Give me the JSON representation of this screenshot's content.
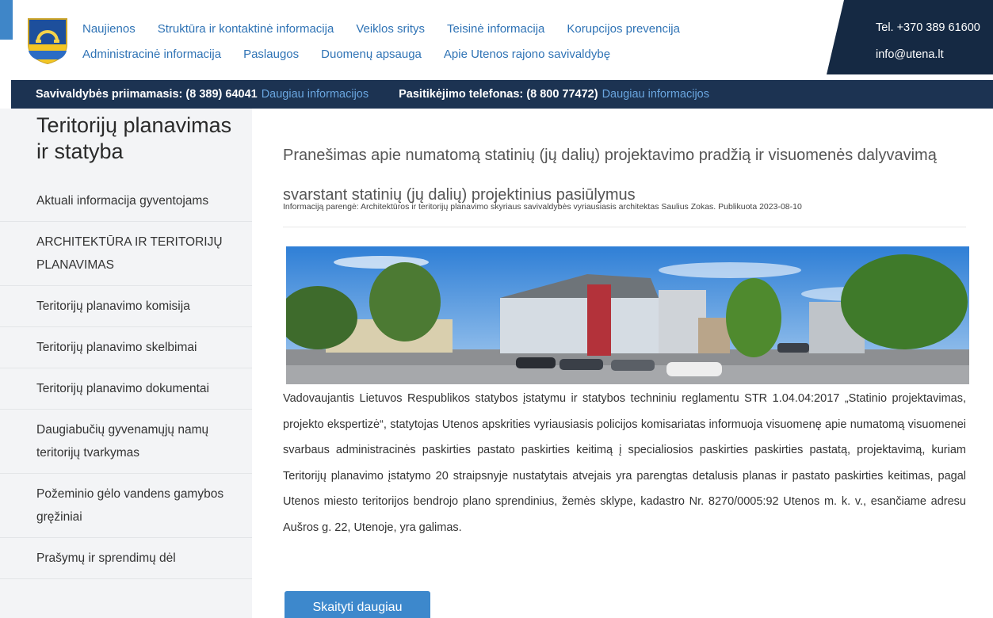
{
  "header": {
    "nav_row1": [
      "Naujienos",
      "Struktūra ir kontaktinė informacija",
      "Veiklos sritys",
      "Teisinė informacija",
      "Korupcijos prevencija"
    ],
    "nav_row2": [
      "Administracinė informacija",
      "Paslaugos",
      "Duomenų apsauga",
      "Apie Utenos rajono savivaldybę"
    ],
    "phone": "Tel. +370 389 61600",
    "email": "info@utena.lt",
    "accent_color": "#3f86c8",
    "dark_color": "#152943"
  },
  "infobar": {
    "reception_label": "Savivaldybės priimamasis: (8 389) 64041",
    "reception_link": "Daugiau informacijos",
    "trust_label": "Pasitikėjimo telefonas: (8 800 77472)",
    "trust_link": "Daugiau informacijos"
  },
  "sidebar": {
    "title": "Teritorijų planavimas ir statyba",
    "items": [
      "Aktuali informacija gyventojams",
      "ARCHITEKTŪRA IR TERITORIJŲ PLANAVIMAS",
      "Teritorijų planavimo komisija",
      "Teritorijų planavimo skelbimai",
      "Teritorijų planavimo dokumentai",
      "Daugiabučių gyvenamųjų namų teritorijų tvarkymas",
      "Požeminio gėlo vandens gamybos gręžiniai",
      "Prašymų ir sprendimų dėl"
    ]
  },
  "article": {
    "title": "Pranešimas apie numatomą statinių (jų dalių) projektavimo pradžią ir visuomenės dalyvavimą svarstant statinių (jų dalių) projektinius pasiūlymus",
    "meta": "Informaciją parengė: Architektūros ir teritorijų planavimo skyriaus savivaldybės vyriausiasis architektas Saulius Zokas. Publikuota 2023-08-10",
    "body": "Vadovaujantis Lietuvos Respublikos statybos įstatymu ir statybos techniniu reglamentu STR 1.04.04:2017 „Statinio projektavimas, projekto ekspertizė“, statytojas Utenos apskrities vyriausiasis policijos komisariatas informuoja visuomenę apie numatomą visuomenei svarbaus administracinės paskirties pastato paskirties keitimą į specialiosios paskirties paskirties pastatą, projektavimą, kuriam Teritorijų planavimo įstatymo 20 straipsnyje nustatytais atvejais yra parengtas detalusis planas ir pastato paskirties keitimas, pagal Utenos miesto teritorijos bendrojo plano sprendinius, žemės sklype, kadastro Nr. 8270/0005:92 Utenos m. k. v., esančiame adresu Aušros g. 22, Utenoje, yra galimas.",
    "read_more": "Skaityti daugiau"
  }
}
